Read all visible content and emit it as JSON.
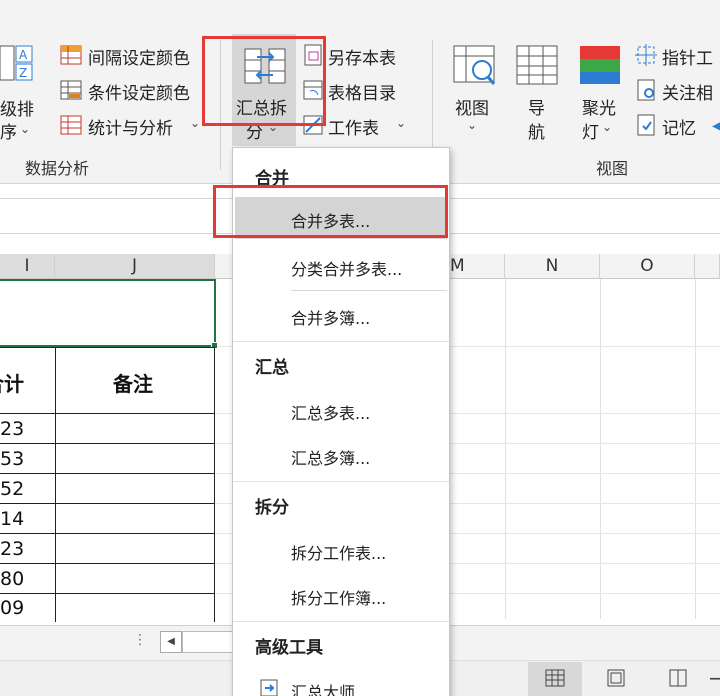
{
  "ribbon": {
    "sort_label_1": "级排",
    "sort_label_2": "序",
    "interval_color": "间隔设定颜色",
    "cond_color": "条件设定颜色",
    "stats_analysis": "统计与分析",
    "data_analysis_group": "数据分析",
    "summary_split_1": "汇总拆",
    "summary_split_2": "分",
    "save_as": "另存本表",
    "table_catalog": "表格目录",
    "worksheet": "工作表",
    "view": "视图",
    "nav_1": "导",
    "nav_2": "航",
    "spotlight_1": "聚光",
    "spotlight_2": "灯",
    "pointer": "指针工",
    "attention": "关注相",
    "memory": "记忆",
    "view_group": "视图"
  },
  "columns": [
    "I",
    "J",
    "M",
    "N",
    "O"
  ],
  "sheet": {
    "header_total": "合计",
    "header_note": "备注",
    "values": [
      "23",
      "53",
      "52",
      "14",
      "23",
      "80",
      "09"
    ]
  },
  "menu": {
    "section_merge": "合并",
    "merge_multi_sheet": "合并多表...",
    "classify_merge": "分类合并多表...",
    "merge_multi_book": "合并多簿...",
    "section_summary": "汇总",
    "summary_multi_sheet": "汇总多表...",
    "summary_multi_book": "汇总多簿...",
    "section_split": "拆分",
    "split_worksheet": "拆分工作表...",
    "split_workbook": "拆分工作簿...",
    "section_advanced": "高级工具",
    "summary_master": "汇总大师..."
  },
  "colors": {
    "highlight_red": "#e53935",
    "accent_blue": "#2b7cd3",
    "cell_select_green": "#217346"
  },
  "icons": [
    "sort-icon",
    "grid-color-icon",
    "stats-icon",
    "summary-split-icon",
    "save-as-icon",
    "catalog-icon",
    "worksheet-icon",
    "view-icon",
    "nav-icon",
    "spotlight-icon",
    "pointer-icon",
    "attention-icon",
    "memory-icon",
    "normal-view-icon",
    "page-layout-icon",
    "page-break-icon"
  ]
}
